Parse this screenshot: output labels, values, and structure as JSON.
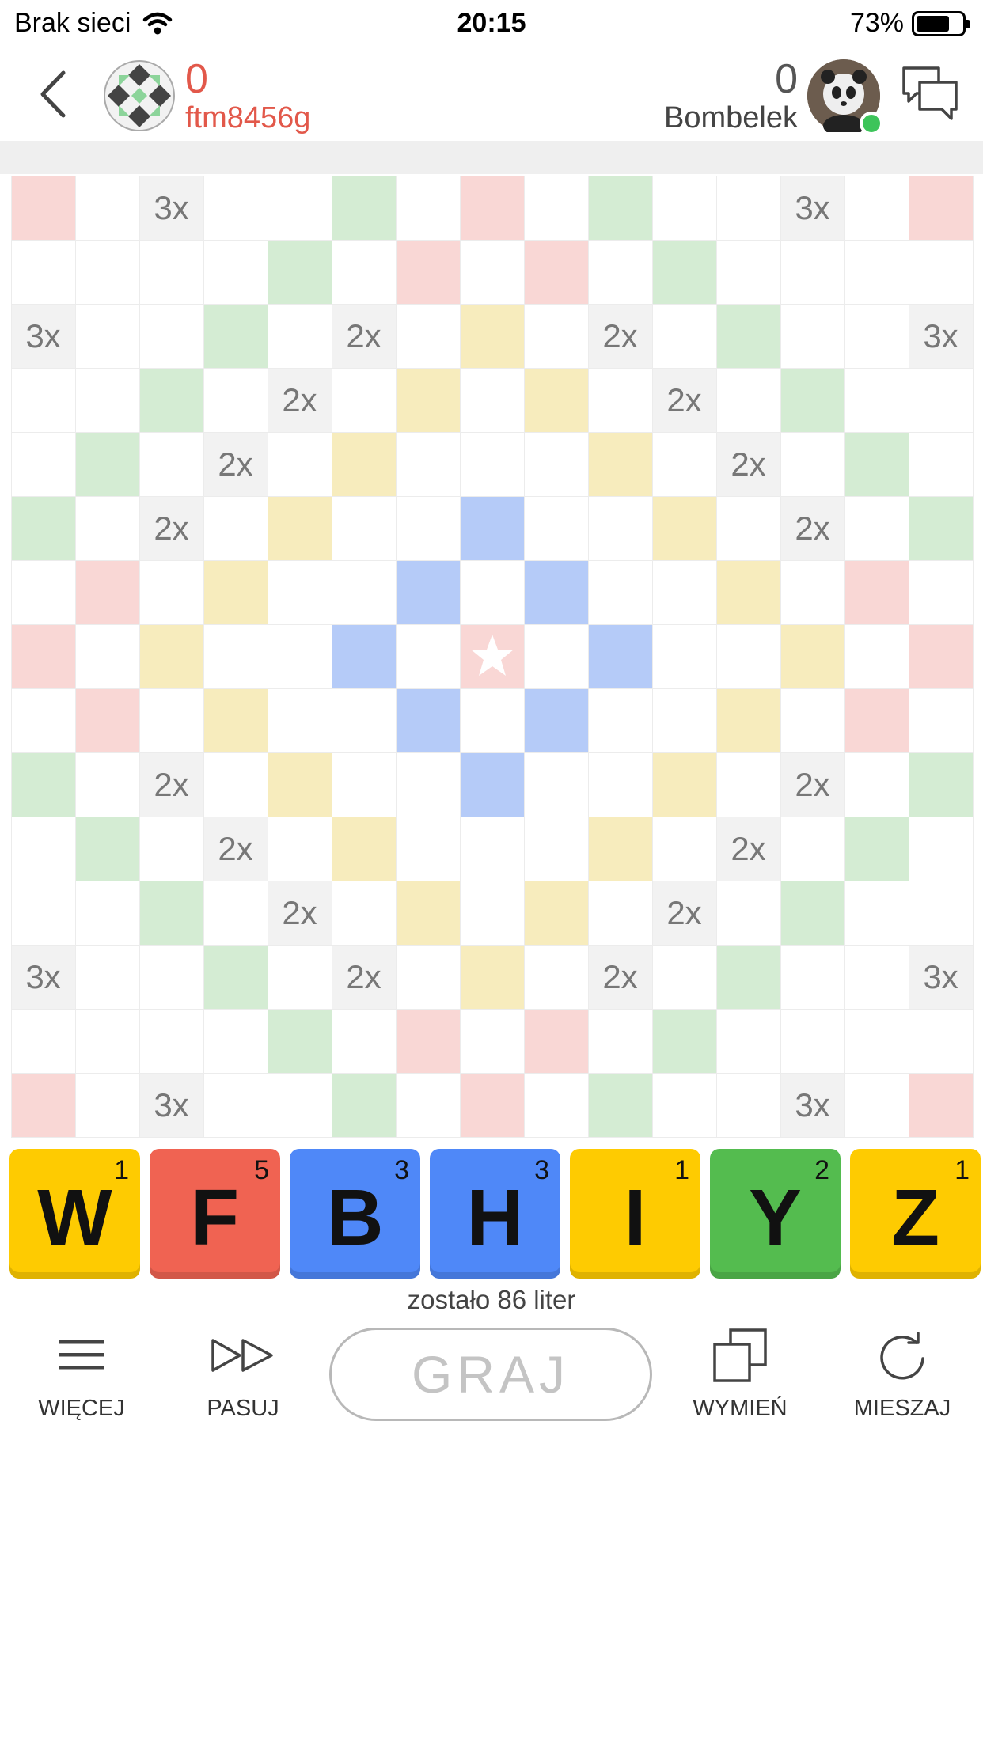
{
  "status_bar": {
    "carrier": "Brak sieci",
    "time": "20:15",
    "battery": "73%",
    "battery_level": 0.73,
    "wifi_icon": "wifi-icon"
  },
  "header": {
    "back_icon": "chevron-left-icon",
    "player1": {
      "score": "0",
      "name": "ftm8456g",
      "color": "#e2584a"
    },
    "player2": {
      "score": "0",
      "name": "Bombelek",
      "online": true
    },
    "chat_icon": "chat-bubbles-icon"
  },
  "board": {
    "size": 15,
    "colors": {
      "red": "#f9d7d5",
      "green": "#d4ecd3",
      "yellow": "#f7ecbd",
      "blue": "#b5cbf8",
      "gray": "#f2f2f2"
    },
    "rows": [
      [
        "R",
        "",
        "G:3x",
        "",
        "",
        "G",
        "",
        "R",
        "",
        "G",
        "",
        "",
        "G:3x",
        "",
        "R"
      ],
      [
        "",
        "",
        "",
        "",
        "G",
        "",
        "R",
        "",
        "R",
        "",
        "G",
        "",
        "",
        "",
        ""
      ],
      [
        "G:3x",
        "",
        "",
        "G",
        "",
        "G:2x",
        "",
        "Y",
        "",
        "G:2x",
        "",
        "G",
        "",
        "",
        "G:3x"
      ],
      [
        "",
        "",
        "G",
        "",
        "G:2x",
        "",
        "Y",
        "",
        "Y",
        "",
        "G:2x",
        "",
        "G",
        "",
        ""
      ],
      [
        "",
        "G",
        "",
        "G:2x",
        "",
        "Y",
        "",
        "",
        "",
        "Y",
        "",
        "G:2x",
        "",
        "G",
        ""
      ],
      [
        "G",
        "",
        "G:2x",
        "",
        "Y",
        "",
        "",
        "B",
        "",
        "",
        "Y",
        "",
        "G:2x",
        "",
        "G"
      ],
      [
        "",
        "R",
        "",
        "Y",
        "",
        "",
        "B",
        "",
        "B",
        "",
        "",
        "Y",
        "",
        "R",
        ""
      ],
      [
        "R",
        "",
        "Y",
        "",
        "",
        "B",
        "",
        "S",
        "",
        "B",
        "",
        "",
        "Y",
        "",
        "R"
      ],
      [
        "",
        "R",
        "",
        "Y",
        "",
        "",
        "B",
        "",
        "B",
        "",
        "",
        "Y",
        "",
        "R",
        ""
      ],
      [
        "G",
        "",
        "G:2x",
        "",
        "Y",
        "",
        "",
        "B",
        "",
        "",
        "Y",
        "",
        "G:2x",
        "",
        "G"
      ],
      [
        "",
        "G",
        "",
        "G:2x",
        "",
        "Y",
        "",
        "",
        "",
        "Y",
        "",
        "G:2x",
        "",
        "G",
        ""
      ],
      [
        "",
        "",
        "G",
        "",
        "G:2x",
        "",
        "Y",
        "",
        "Y",
        "",
        "G:2x",
        "",
        "G",
        "",
        ""
      ],
      [
        "G:3x",
        "",
        "",
        "G",
        "",
        "G:2x",
        "",
        "Y",
        "",
        "G:2x",
        "",
        "G",
        "",
        "",
        "G:3x"
      ],
      [
        "",
        "",
        "",
        "",
        "G",
        "",
        "R",
        "",
        "R",
        "",
        "G",
        "",
        "",
        "",
        ""
      ],
      [
        "R",
        "",
        "G:3x",
        "",
        "",
        "G",
        "",
        "R",
        "",
        "G",
        "",
        "",
        "G:3x",
        "",
        "R"
      ]
    ]
  },
  "rack": [
    {
      "letter": "W",
      "points": "1",
      "color": "#fecb01"
    },
    {
      "letter": "F",
      "points": "5",
      "color": "#f06352"
    },
    {
      "letter": "B",
      "points": "3",
      "color": "#4f88f8"
    },
    {
      "letter": "H",
      "points": "3",
      "color": "#4f88f8"
    },
    {
      "letter": "I",
      "points": "1",
      "color": "#fecb01"
    },
    {
      "letter": "Y",
      "points": "2",
      "color": "#54bc4f"
    },
    {
      "letter": "Z",
      "points": "1",
      "color": "#fecb01"
    }
  ],
  "remaining_text": "zostało 86 liter",
  "toolbar": {
    "more": {
      "label": "WIĘCEJ",
      "icon": "menu-icon"
    },
    "pass": {
      "label": "PASUJ",
      "icon": "fast-forward-icon"
    },
    "play": {
      "label": "GRAJ"
    },
    "exchange": {
      "label": "WYMIEŃ",
      "icon": "copy-icon"
    },
    "shuffle": {
      "label": "MIESZAJ",
      "icon": "refresh-icon"
    }
  }
}
